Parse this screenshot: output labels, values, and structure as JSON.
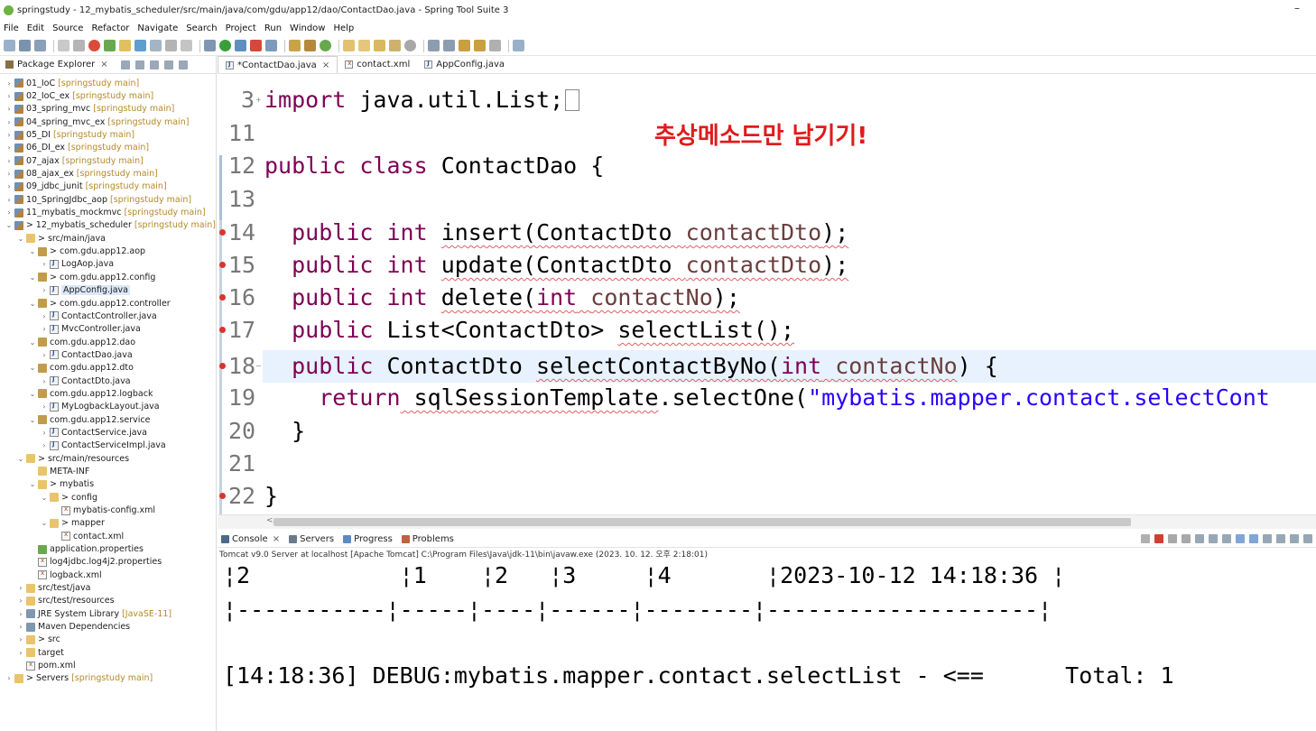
{
  "window": {
    "title": "springstudy - 12_mybatis_scheduler/src/main/java/com/gdu/app12/dao/ContactDao.java - Spring Tool Suite 3",
    "minimize": "–"
  },
  "menu": [
    "File",
    "Edit",
    "Source",
    "Refactor",
    "Navigate",
    "Search",
    "Project",
    "Run",
    "Window",
    "Help"
  ],
  "explorer": {
    "title": "Package Explorer",
    "close": "×",
    "tree": [
      {
        "label": "01_IoC",
        "meta": "[springstudy main]",
        "icon": "project",
        "chev": ">",
        "indent": 0
      },
      {
        "label": "02_IoC_ex",
        "meta": "[springstudy main]",
        "icon": "project",
        "chev": ">",
        "indent": 0
      },
      {
        "label": "03_spring_mvc",
        "meta": "[springstudy main]",
        "icon": "project",
        "chev": ">",
        "indent": 0
      },
      {
        "label": "04_spring_mvc_ex",
        "meta": "[springstudy main]",
        "icon": "project",
        "chev": ">",
        "indent": 0
      },
      {
        "label": "05_DI",
        "meta": "[springstudy main]",
        "icon": "project",
        "chev": ">",
        "indent": 0
      },
      {
        "label": "06_DI_ex",
        "meta": "[springstudy main]",
        "icon": "project",
        "chev": ">",
        "indent": 0
      },
      {
        "label": "07_ajax",
        "meta": "[springstudy main]",
        "icon": "project",
        "chev": ">",
        "indent": 0
      },
      {
        "label": "08_ajax_ex",
        "meta": "[springstudy main]",
        "icon": "project",
        "chev": ">",
        "indent": 0
      },
      {
        "label": "09_jdbc_junit",
        "meta": "[springstudy main]",
        "icon": "project",
        "chev": ">",
        "indent": 0
      },
      {
        "label": "10_SpringJdbc_aop",
        "meta": "[springstudy main]",
        "icon": "project",
        "chev": ">",
        "indent": 0
      },
      {
        "label": "11_mybatis_mockmvc",
        "meta": "[springstudy main]",
        "icon": "project",
        "chev": ">",
        "indent": 0
      },
      {
        "label": "> 12_mybatis_scheduler",
        "meta": "[springstudy main]",
        "icon": "project",
        "chev": "v",
        "indent": 0
      },
      {
        "label": "> src/main/java",
        "meta": "",
        "icon": "folder",
        "chev": "v",
        "indent": 1
      },
      {
        "label": "> com.gdu.app12.aop",
        "meta": "",
        "icon": "pkg",
        "chev": "v",
        "indent": 2
      },
      {
        "label": "LogAop.java",
        "meta": "",
        "icon": "java",
        "chev": ">",
        "indent": 3
      },
      {
        "label": "> com.gdu.app12.config",
        "meta": "",
        "icon": "pkg",
        "chev": "v",
        "indent": 2
      },
      {
        "label": "AppConfig.java",
        "meta": "",
        "icon": "java",
        "chev": ">",
        "indent": 3,
        "selected": true
      },
      {
        "label": "> com.gdu.app12.controller",
        "meta": "",
        "icon": "pkg",
        "chev": "v",
        "indent": 2
      },
      {
        "label": "ContactController.java",
        "meta": "",
        "icon": "java",
        "chev": ">",
        "indent": 3
      },
      {
        "label": "MvcController.java",
        "meta": "",
        "icon": "java",
        "chev": ">",
        "indent": 3
      },
      {
        "label": "com.gdu.app12.dao",
        "meta": "",
        "icon": "pkg",
        "chev": "v",
        "indent": 2
      },
      {
        "label": "ContactDao.java",
        "meta": "",
        "icon": "java",
        "chev": ">",
        "indent": 3
      },
      {
        "label": "com.gdu.app12.dto",
        "meta": "",
        "icon": "pkg",
        "chev": "v",
        "indent": 2
      },
      {
        "label": "ContactDto.java",
        "meta": "",
        "icon": "java",
        "chev": ">",
        "indent": 3
      },
      {
        "label": "com.gdu.app12.logback",
        "meta": "",
        "icon": "pkg",
        "chev": "v",
        "indent": 2
      },
      {
        "label": "MyLogbackLayout.java",
        "meta": "",
        "icon": "java",
        "chev": ">",
        "indent": 3
      },
      {
        "label": "com.gdu.app12.service",
        "meta": "",
        "icon": "pkg",
        "chev": "v",
        "indent": 2
      },
      {
        "label": "ContactService.java",
        "meta": "",
        "icon": "java",
        "chev": ">",
        "indent": 3
      },
      {
        "label": "ContactServiceImpl.java",
        "meta": "",
        "icon": "java",
        "chev": ">",
        "indent": 3
      },
      {
        "label": "> src/main/resources",
        "meta": "",
        "icon": "folder",
        "chev": "v",
        "indent": 1
      },
      {
        "label": "META-INF",
        "meta": "",
        "icon": "folder",
        "chev": "",
        "indent": 2
      },
      {
        "label": "> mybatis",
        "meta": "",
        "icon": "folder",
        "chev": "v",
        "indent": 2
      },
      {
        "label": "> config",
        "meta": "",
        "icon": "folder",
        "chev": "v",
        "indent": 3
      },
      {
        "label": "mybatis-config.xml",
        "meta": "",
        "icon": "xml",
        "chev": "",
        "indent": 4
      },
      {
        "label": "> mapper",
        "meta": "",
        "icon": "folder",
        "chev": "v",
        "indent": 3
      },
      {
        "label": "contact.xml",
        "meta": "",
        "icon": "xml",
        "chev": "",
        "indent": 4
      },
      {
        "label": "application.properties",
        "meta": "",
        "icon": "prop",
        "chev": "",
        "indent": 2
      },
      {
        "label": "log4jdbc.log4j2.properties",
        "meta": "",
        "icon": "xml",
        "chev": "",
        "indent": 2
      },
      {
        "label": "logback.xml",
        "meta": "",
        "icon": "xml",
        "chev": "",
        "indent": 2
      },
      {
        "label": "src/test/java",
        "meta": "",
        "icon": "folder",
        "chev": ">",
        "indent": 1
      },
      {
        "label": "src/test/resources",
        "meta": "",
        "icon": "folder",
        "chev": ">",
        "indent": 1
      },
      {
        "label": "JRE System Library",
        "meta": "[JavaSE-11]",
        "icon": "lib",
        "chev": ">",
        "indent": 1
      },
      {
        "label": "Maven Dependencies",
        "meta": "",
        "icon": "lib",
        "chev": ">",
        "indent": 1
      },
      {
        "label": "> src",
        "meta": "",
        "icon": "folder",
        "chev": ">",
        "indent": 1
      },
      {
        "label": "target",
        "meta": "",
        "icon": "folder",
        "chev": ">",
        "indent": 1
      },
      {
        "label": "pom.xml",
        "meta": "",
        "icon": "xml",
        "chev": "",
        "indent": 1
      },
      {
        "label": "> Servers",
        "meta": "[springstudy main]",
        "icon": "folder",
        "chev": ">",
        "indent": 0
      }
    ]
  },
  "editor": {
    "tabs": [
      {
        "label": "*ContactDao.java",
        "active": true,
        "close": "×"
      },
      {
        "label": "contact.xml",
        "active": false,
        "close": ""
      },
      {
        "label": "AppConfig.java",
        "active": false,
        "close": ""
      }
    ],
    "annotation": "추상메소드만 남기기!",
    "lines": {
      "l3": {
        "num": "3"
      },
      "l11": {
        "num": "11"
      },
      "l12": {
        "num": "12"
      },
      "l13": {
        "num": "13"
      },
      "l14": {
        "num": "14"
      },
      "l15": {
        "num": "15"
      },
      "l16": {
        "num": "16"
      },
      "l17": {
        "num": "17"
      },
      "l18": {
        "num": "18"
      },
      "l19": {
        "num": "19"
      },
      "l20": {
        "num": "20"
      },
      "l21": {
        "num": "21"
      },
      "l22": {
        "num": "22"
      }
    },
    "tokens": {
      "import_kw": "import",
      "import_rest": " java.util.List;",
      "public": "public",
      "class": "class",
      "class_name": " ContactDao {",
      "int": "int",
      "insert": "insert",
      "update": "update",
      "delete": "delete",
      "ContactDto_paren": "(ContactDto ",
      "contactDto": "contactDto",
      "paren_end": ");",
      "open_paren": "(",
      "contactNo": "contactNo",
      "list_type": " List<ContactDto> ",
      "selectList": "selectList();",
      "dto_type": " ContactDto ",
      "selectContactByNo": "selectContactByNo(",
      "close_brace_open": ") {",
      "return": "return",
      "sql_call": " sqlSessionTemplate",
      "select_one": ".selectOne(",
      "mapper_str": "\"mybatis.mapper.contact.selectCont",
      "close_brace": "}"
    }
  },
  "console": {
    "tabs": [
      {
        "label": "Console",
        "close": "×"
      },
      {
        "label": "Servers",
        "close": ""
      },
      {
        "label": "Progress",
        "close": ""
      },
      {
        "label": "Problems",
        "close": ""
      }
    ],
    "description": "Tomcat v9.0 Server at localhost [Apache Tomcat] C:\\Program Files\\Java\\jdk-11\\bin\\javaw.exe  (2023. 10. 12. 오후 2:18:01)",
    "lines": [
      "¦2           ¦1    ¦2   ¦3     ¦4       ¦2023-10-12 14:18:36 ¦",
      "¦-----------¦-----¦----¦------¦--------¦--------------------¦",
      "",
      "[14:18:36] DEBUG:mybatis.mapper.contact.selectList - <==      Total: 1"
    ]
  }
}
